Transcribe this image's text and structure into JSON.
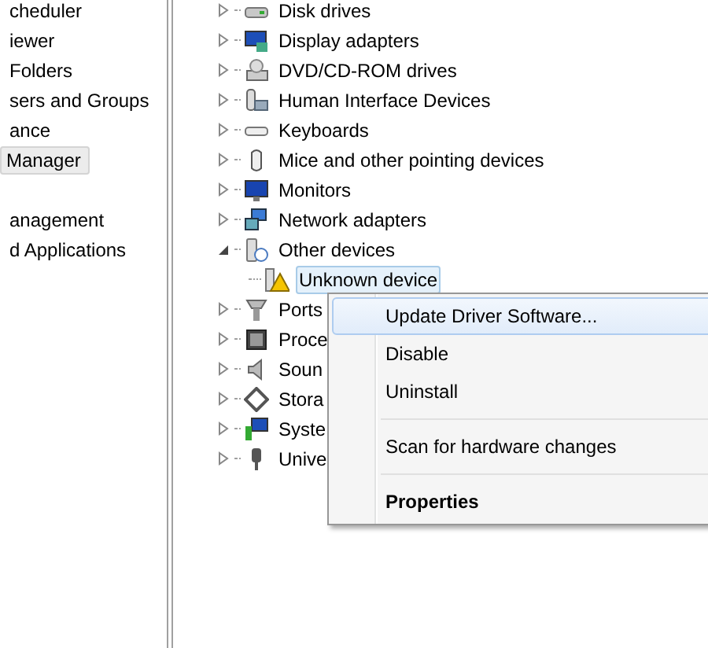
{
  "left_pane": {
    "items": [
      {
        "label": "cheduler",
        "selected": false
      },
      {
        "label": "iewer",
        "selected": false
      },
      {
        "label": "Folders",
        "selected": false
      },
      {
        "label": "sers and Groups",
        "selected": false
      },
      {
        "label": "ance",
        "selected": false
      },
      {
        "label": "Manager",
        "selected": true
      },
      {
        "label": "anagement",
        "selected": false
      },
      {
        "label": "d Applications",
        "selected": false
      }
    ]
  },
  "device_tree": {
    "items": [
      {
        "label": "Disk drives",
        "expanded": false,
        "selected": false
      },
      {
        "label": "Display adapters",
        "expanded": false,
        "selected": false
      },
      {
        "label": "DVD/CD-ROM drives",
        "expanded": false,
        "selected": false
      },
      {
        "label": "Human Interface Devices",
        "expanded": false,
        "selected": false
      },
      {
        "label": "Keyboards",
        "expanded": false,
        "selected": false
      },
      {
        "label": "Mice and other pointing devices",
        "expanded": false,
        "selected": false
      },
      {
        "label": "Monitors",
        "expanded": false,
        "selected": false
      },
      {
        "label": "Network adapters",
        "expanded": false,
        "selected": false
      },
      {
        "label": "Other devices",
        "expanded": true,
        "selected": false,
        "children": [
          {
            "label": "Unknown device",
            "selected": true
          }
        ]
      },
      {
        "label": "Ports",
        "expanded": false,
        "selected": false
      },
      {
        "label": "Proce",
        "expanded": false,
        "selected": false
      },
      {
        "label": "Soun",
        "expanded": false,
        "selected": false
      },
      {
        "label": "Stora",
        "expanded": false,
        "selected": false
      },
      {
        "label": "Syste",
        "expanded": false,
        "selected": false
      },
      {
        "label": "Unive",
        "expanded": false,
        "selected": false
      }
    ]
  },
  "context_menu": {
    "items": [
      {
        "kind": "item",
        "label": "Update Driver Software...",
        "selected": true,
        "default": false
      },
      {
        "kind": "item",
        "label": "Disable",
        "selected": false,
        "default": false
      },
      {
        "kind": "item",
        "label": "Uninstall",
        "selected": false,
        "default": false
      },
      {
        "kind": "separator"
      },
      {
        "kind": "item",
        "label": "Scan for hardware changes",
        "selected": false,
        "default": false
      },
      {
        "kind": "separator"
      },
      {
        "kind": "item",
        "label": "Properties",
        "selected": false,
        "default": true
      }
    ]
  }
}
